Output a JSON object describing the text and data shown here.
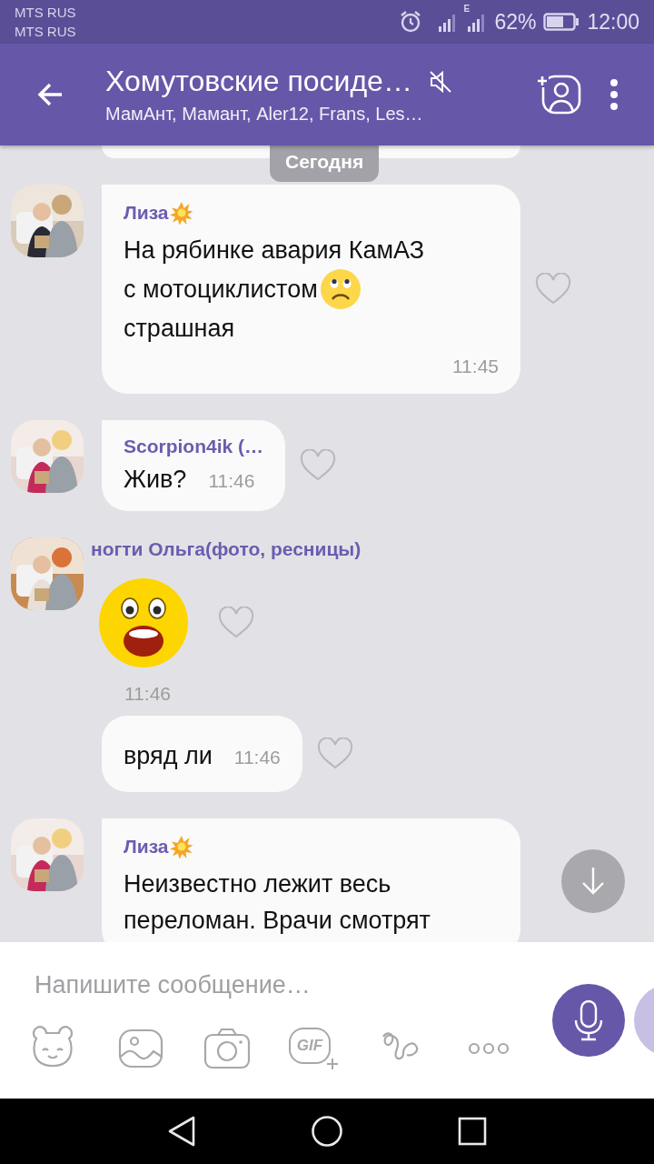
{
  "status_bar": {
    "carriers": [
      "MTS RUS",
      "MTS RUS"
    ],
    "network_type": "E",
    "battery_percent": "62%",
    "time": "12:00"
  },
  "header": {
    "title": "Хомутовские посиде…",
    "subtitle": "МамАнт, Мамант, Aler12, Frans, Les…",
    "muted": true
  },
  "chat": {
    "date_label": "Сегодня",
    "messages": [
      {
        "kind": "text",
        "has_avatar": true,
        "sender": "Лиза",
        "burst_badge": true,
        "lines": [
          {
            "text": "На рябинке авария КамАЗ"
          },
          {
            "text": "с мотоциклистом",
            "sad_face": true
          },
          {
            "text": "страшная"
          }
        ],
        "time": "11:45",
        "liked": false
      },
      {
        "kind": "inline",
        "has_avatar": true,
        "sender": "Scorpion4ik (…",
        "lines": [
          {
            "text": "Жив?"
          }
        ],
        "time": "11:46",
        "liked": false
      },
      {
        "kind": "sticker",
        "has_avatar": true,
        "sender": "ногти Ольга(фото, ресницы)",
        "time": "11:46",
        "liked": false
      },
      {
        "kind": "inline",
        "has_avatar": false,
        "lines": [
          {
            "text": "вряд ли"
          }
        ],
        "time": "11:46",
        "liked": false
      },
      {
        "kind": "text",
        "has_avatar": true,
        "sender": "Лиза",
        "burst_badge": true,
        "lines": [
          {
            "text": "Неизвестно лежит весь"
          },
          {
            "text": "переломан. Врачи смотрят"
          }
        ]
      }
    ]
  },
  "composer": {
    "placeholder": "Напишите сообщение…",
    "gif_label": "GIF"
  }
}
